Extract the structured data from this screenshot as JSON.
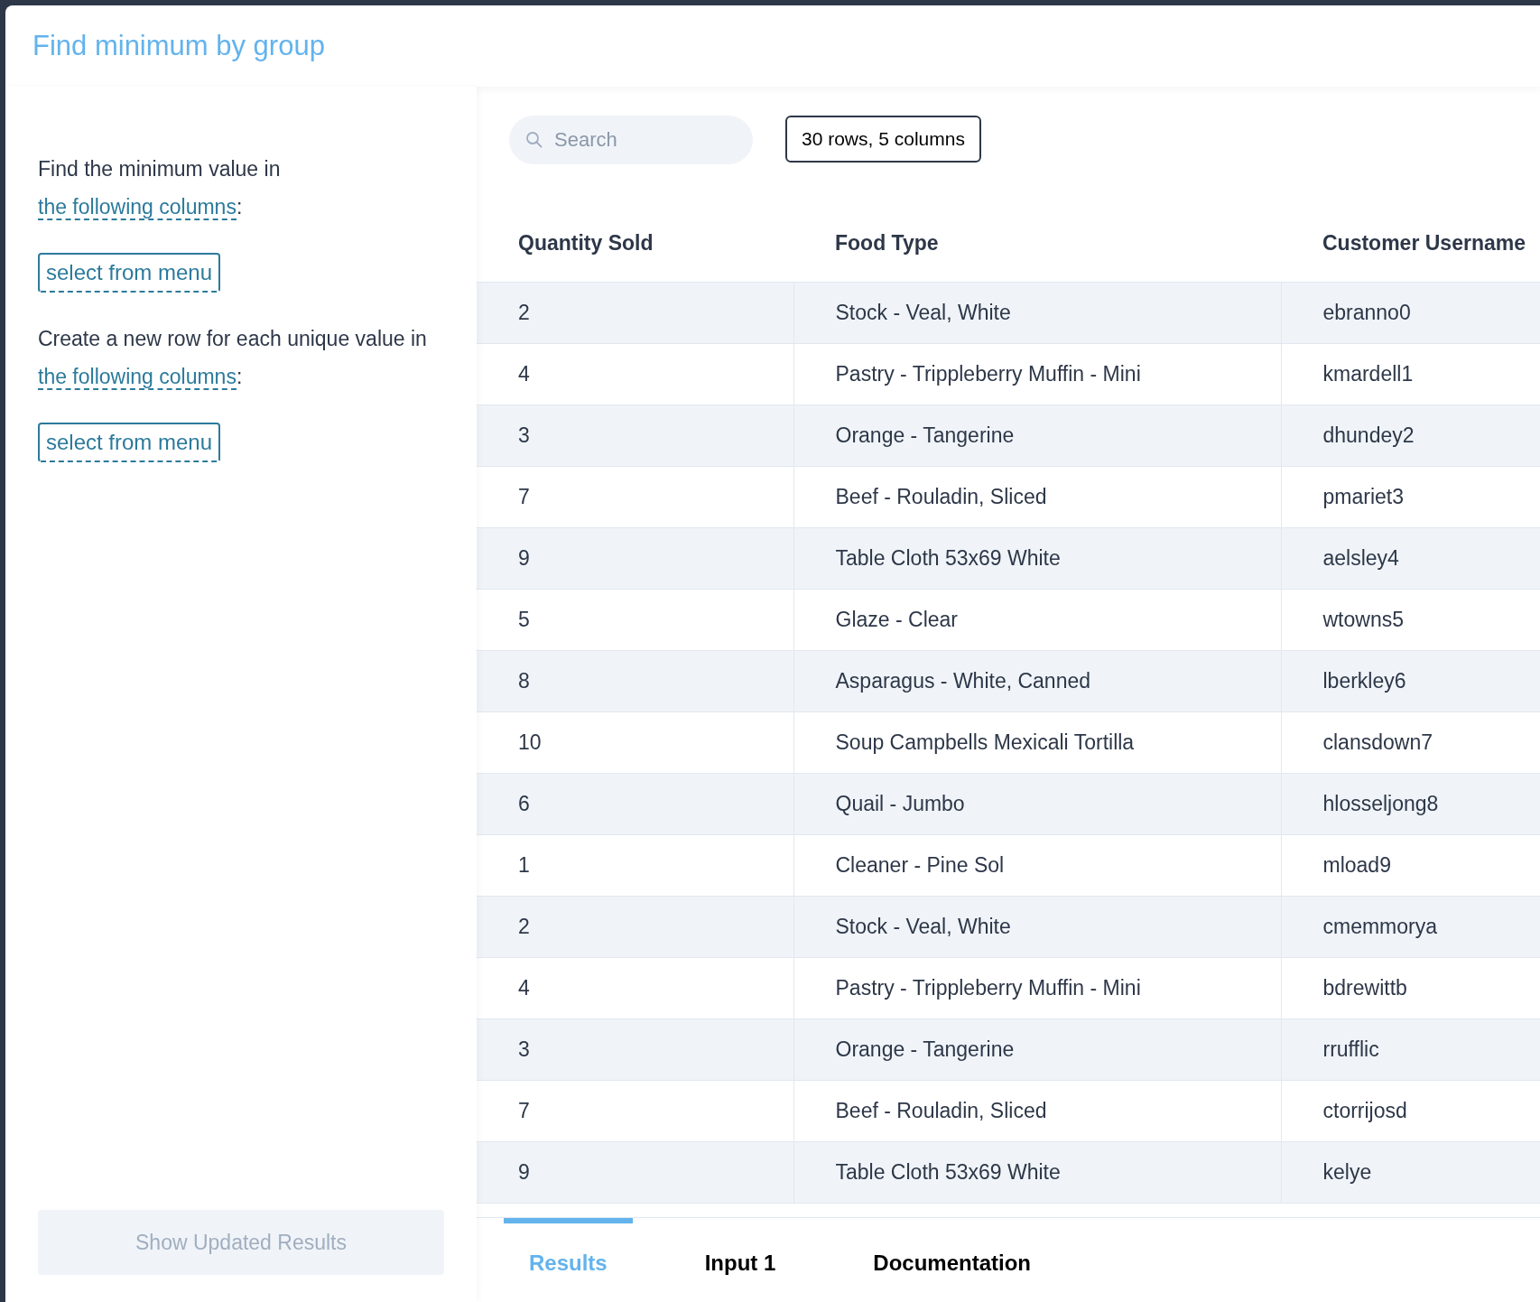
{
  "title": "Find minimum by group",
  "prompts": [
    {
      "before": "Find the minimum value in ",
      "link": "the following columns",
      "after": ":",
      "selector": "select from menu"
    },
    {
      "before": "Create a new row for each unique value in ",
      "link": "the following columns",
      "after": ":",
      "selector": "select from menu"
    }
  ],
  "apply_button": {
    "label": "Show Updated Results",
    "disabled": true
  },
  "search": {
    "placeholder": "Search"
  },
  "summary": "30 rows, 5 columns",
  "table": {
    "columns": [
      "Quantity Sold",
      "Food Type",
      "Customer Username"
    ],
    "rows": [
      [
        "2",
        "Stock - Veal, White",
        "ebranno0"
      ],
      [
        "4",
        "Pastry - Trippleberry Muffin - Mini",
        "kmardell1"
      ],
      [
        "3",
        "Orange - Tangerine",
        "dhundey2"
      ],
      [
        "7",
        "Beef - Rouladin, Sliced",
        "pmariet3"
      ],
      [
        "9",
        "Table Cloth 53x69 White",
        "aelsley4"
      ],
      [
        "5",
        "Glaze - Clear",
        "wtowns5"
      ],
      [
        "8",
        "Asparagus - White, Canned",
        "lberkley6"
      ],
      [
        "10",
        "Soup Campbells Mexicali Tortilla",
        "clansdown7"
      ],
      [
        "6",
        "Quail - Jumbo",
        "hlosseljong8"
      ],
      [
        "1",
        "Cleaner - Pine Sol",
        "mload9"
      ],
      [
        "2",
        "Stock - Veal, White",
        "cmemmorya"
      ],
      [
        "4",
        "Pastry - Trippleberry Muffin - Mini",
        "bdrewittb"
      ],
      [
        "3",
        "Orange - Tangerine",
        "rrufflic"
      ],
      [
        "7",
        "Beef - Rouladin, Sliced",
        "ctorrijosd"
      ],
      [
        "9",
        "Table Cloth 53x69 White",
        "kelye"
      ]
    ]
  },
  "tabs": [
    {
      "label": "Results",
      "selected": true
    },
    {
      "label": "Input 1",
      "selected": false
    },
    {
      "label": "Documentation",
      "selected": false
    }
  ]
}
